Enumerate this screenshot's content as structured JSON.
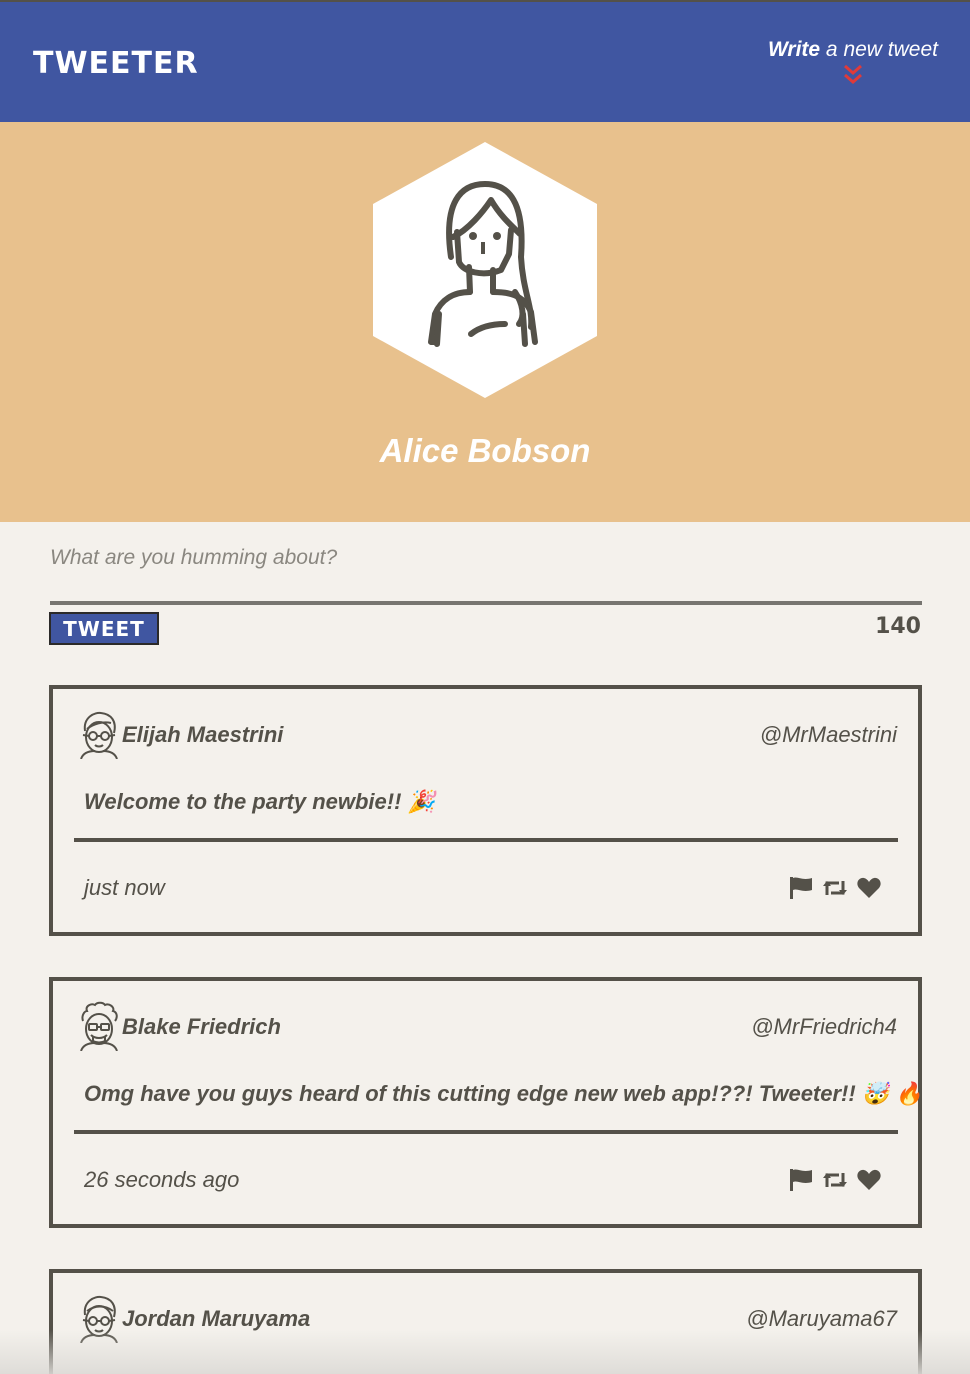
{
  "header": {
    "brand": "TWEETER",
    "compose_strong": "Write",
    "compose_rest": " a new tweet"
  },
  "profile": {
    "name": "Alice Bobson"
  },
  "composer": {
    "placeholder": "What are you humming about?",
    "button_label": "TWEET",
    "char_count": "140"
  },
  "tweets": [
    {
      "author": "Elijah Maestrini",
      "handle": "@MrMaestrini",
      "content": "Welcome to the party newbie!! 🎉",
      "time": "just now"
    },
    {
      "author": "Blake Friedrich",
      "handle": "@MrFriedrich4",
      "content": "Omg have you guys heard of this cutting edge new web app!??! Tweeter!! 🤯 🔥",
      "time": "26 seconds ago"
    },
    {
      "author": "Jordan Maruyama",
      "handle": "@Maruyama67",
      "content": "",
      "time": ""
    }
  ],
  "icons": {
    "chevron": "double-chevron-down-icon",
    "flag": "flag-icon",
    "retweet": "retweet-icon",
    "like": "heart-icon"
  },
  "colors": {
    "header_bg": "#4056a1",
    "profile_bg": "#e8c18d",
    "page_bg": "#f4f1ec",
    "text": "#545149",
    "chevron": "#e03a3a"
  }
}
